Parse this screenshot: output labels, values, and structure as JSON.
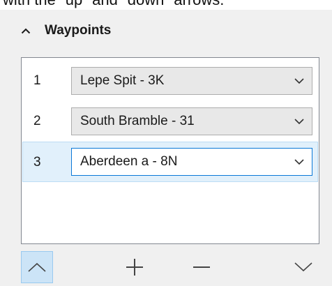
{
  "caption": {
    "text": "with the \"up\" and \"down\" arrows."
  },
  "panel": {
    "title": "Waypoints",
    "collapse_icon": "chevron-up-icon"
  },
  "waypoints": [
    {
      "number": "1",
      "value": "Lepe Spit - 3K",
      "selected": false
    },
    {
      "number": "2",
      "value": "South Bramble - 31",
      "selected": false
    },
    {
      "number": "3",
      "value": "Aberdeen a - 8N",
      "selected": true
    }
  ],
  "toolbar": {
    "move_up_icon": "chevron-up-icon",
    "add_icon": "plus-icon",
    "remove_icon": "minus-icon",
    "move_down_icon": "chevron-down-icon"
  },
  "colors": {
    "panel_bg": "#f0f0f0",
    "selection_bg": "#e1f0fb",
    "focus_border": "#0a78d7",
    "active_button_bg": "#cce4f7"
  }
}
